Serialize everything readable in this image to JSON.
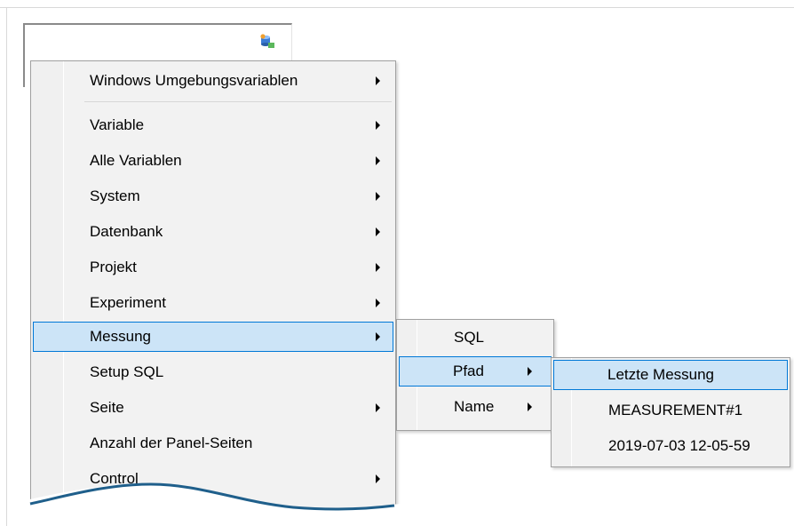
{
  "main_menu": {
    "items": [
      {
        "label": "Windows Umgebungsvariablen",
        "submenu": true
      },
      {
        "label": "Variable",
        "submenu": true
      },
      {
        "label": "Alle Variablen",
        "submenu": true
      },
      {
        "label": "System",
        "submenu": true
      },
      {
        "label": "Datenbank",
        "submenu": true
      },
      {
        "label": "Projekt",
        "submenu": true
      },
      {
        "label": "Experiment",
        "submenu": true
      },
      {
        "label": "Messung",
        "submenu": true,
        "highlighted": true
      },
      {
        "label": "Setup SQL",
        "submenu": false
      },
      {
        "label": "Seite",
        "submenu": true
      },
      {
        "label": "Anzahl der Panel-Seiten",
        "submenu": false
      },
      {
        "label": "Control",
        "submenu": true
      }
    ]
  },
  "messung_submenu": {
    "items": [
      {
        "label": "SQL",
        "submenu": false
      },
      {
        "label": "Pfad",
        "submenu": true,
        "highlighted": true
      },
      {
        "label": "Name",
        "submenu": true
      }
    ]
  },
  "pfad_submenu": {
    "items": [
      {
        "label": "Letzte Messung",
        "highlighted": true
      },
      {
        "label": "MEASUREMENT#1"
      },
      {
        "label": "2019-07-03 12-05-59"
      }
    ]
  },
  "colors": {
    "highlight_fill": "#cce4f7",
    "highlight_border": "#0078d7",
    "menu_background": "#f2f2f2",
    "wave": "#1f5f8b"
  },
  "icons": {
    "input_box_icon": "database-icon"
  }
}
